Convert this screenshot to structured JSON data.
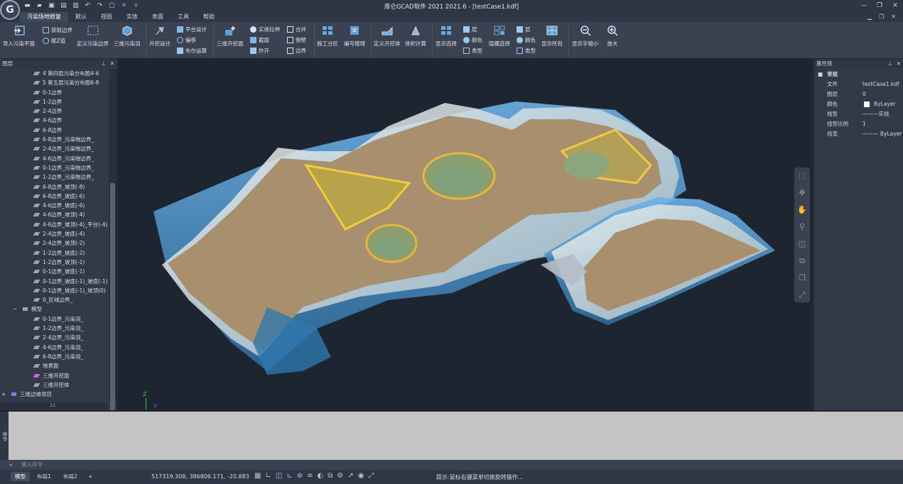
{
  "app": {
    "title": "库仑GCAD软件 2021 2021.6 - [testCase1.kdf]"
  },
  "quick_access": [
    "new",
    "open",
    "save",
    "save-as",
    "print",
    "undo",
    "redo",
    "window",
    "close-x",
    "dropdown"
  ],
  "menu": [
    {
      "label": "污染场地修复",
      "active": true
    },
    {
      "label": "默认",
      "active": false
    },
    {
      "label": "视图",
      "active": false
    },
    {
      "label": "实体",
      "active": false
    },
    {
      "label": "表面",
      "active": false
    },
    {
      "label": "工具",
      "active": false
    },
    {
      "label": "帮助",
      "active": false
    }
  ],
  "ribbon": {
    "import_plane": "导入污染平面",
    "get_boundary": "获取边界",
    "assign_z": "赋Z值",
    "define_boundary": "定义污染边界",
    "three_d_feather": "三维污染羽",
    "excavation_design": "开挖设计",
    "platform_design": "平台设计",
    "offset": "偏移",
    "boolean_op": "布尔运算",
    "three_d_excavation_surface": "三维开挖面",
    "solid_extrude": "实体拉伸",
    "section": "截面",
    "explode": "炸开",
    "merge": "合并",
    "side_wall": "侧壁",
    "boundary": "边界",
    "construction_zone": "施工分区",
    "numbering_extract": "编号搜理",
    "define_excavation_body": "定义开挖体",
    "volume_calc": "体积计算",
    "show_select": "显示选择",
    "layer": "层",
    "color": "颜色",
    "type": "类型",
    "hide_select": "隐藏选择",
    "layer2": "层",
    "color2": "颜色",
    "type2": "类型",
    "show_all": "显示所有",
    "zoom_out": "显示字缩小",
    "zoom_in": "放大"
  },
  "layer_panel": {
    "title": "图层",
    "items": [
      {
        "label": "4 第四层污染分布图4-6",
        "indent": 60
      },
      {
        "label": "5 第五层污染分布图6-8",
        "indent": 60
      },
      {
        "label": "0-1边界",
        "indent": 60
      },
      {
        "label": "1-2边界",
        "indent": 60
      },
      {
        "label": "2-4边界",
        "indent": 60
      },
      {
        "label": "4-6边界",
        "indent": 60
      },
      {
        "label": "6-8边界",
        "indent": 60
      },
      {
        "label": "6-8边界_污染物边界_",
        "indent": 60
      },
      {
        "label": "2-4边界_污染物边界_",
        "indent": 60
      },
      {
        "label": "4-6边界_污染物边界_",
        "indent": 60
      },
      {
        "label": "0-1边界_污染物边界_",
        "indent": 60
      },
      {
        "label": "1-2边界_污染物边界_",
        "indent": 60
      },
      {
        "label": "6-8边界_坡顶(-8)",
        "indent": 60
      },
      {
        "label": "6-8边界_坡底(-6)",
        "indent": 60
      },
      {
        "label": "4-6边界_坡底(-6)",
        "indent": 60
      },
      {
        "label": "4-6边界_坡顶(-4)",
        "indent": 60
      },
      {
        "label": "4-6边界_坡顶(-4)_平台(-4)",
        "indent": 60
      },
      {
        "label": "2-4边界_坡底(-4)",
        "indent": 60
      },
      {
        "label": "2-4边界_坡顶(-2)",
        "indent": 60
      },
      {
        "label": "1-2边界_坡底(-2)",
        "indent": 60
      },
      {
        "label": "1-2边界_坡顶(-1)",
        "indent": 60
      },
      {
        "label": "0-1边界_坡底(-1)",
        "indent": 60
      },
      {
        "label": "0-1边界_坡底(-1)_坡底(-1)",
        "indent": 60
      },
      {
        "label": "0-1边界_坡底(-1)_坡顶(0)",
        "indent": 60
      },
      {
        "label": "0_区域边界_",
        "indent": 60
      },
      {
        "label": "模型",
        "indent": 44,
        "group": true
      },
      {
        "label": "0-1边界_污染羽_",
        "indent": 60
      },
      {
        "label": "1-2边界_污染羽_",
        "indent": 60
      },
      {
        "label": "2-4边界_污染羽_",
        "indent": 60
      },
      {
        "label": "4-6边界_污染羽_",
        "indent": 60
      },
      {
        "label": "6-8边界_污染羽_",
        "indent": 60
      },
      {
        "label": "地表面",
        "indent": 60
      },
      {
        "label": "三维开挖面",
        "indent": 60,
        "accent": "#d55fd6"
      },
      {
        "label": "三维开挖体",
        "indent": 60
      },
      {
        "label": "三维边坡项目",
        "indent": 28,
        "root": true
      }
    ],
    "hscroll_label": "11"
  },
  "properties": {
    "title": "属性框",
    "section": "常规",
    "rows": [
      {
        "key": "文件",
        "value": "testCase1.kdf"
      },
      {
        "key": "图层",
        "value": "0"
      },
      {
        "key": "颜色",
        "value": "ByLayer"
      },
      {
        "key": "线型",
        "value": "———实线"
      },
      {
        "key": "线型比例",
        "value": "1"
      },
      {
        "key": "线宽",
        "value": "——— ByLayer"
      }
    ]
  },
  "viewport": {
    "axis_z": "Z",
    "axis_y": "Y"
  },
  "command": {
    "side_label": "命令",
    "placeholder": "键入命令"
  },
  "status": {
    "tabs": [
      {
        "label": "模型",
        "active": true
      },
      {
        "label": "布局1",
        "active": false
      },
      {
        "label": "布局2",
        "active": false
      },
      {
        "label": "+",
        "active": false
      }
    ],
    "coords": "517319.308, 386806.171, -20.883",
    "hint": "提示:鼠标右键菜单切换旋转操作..."
  }
}
